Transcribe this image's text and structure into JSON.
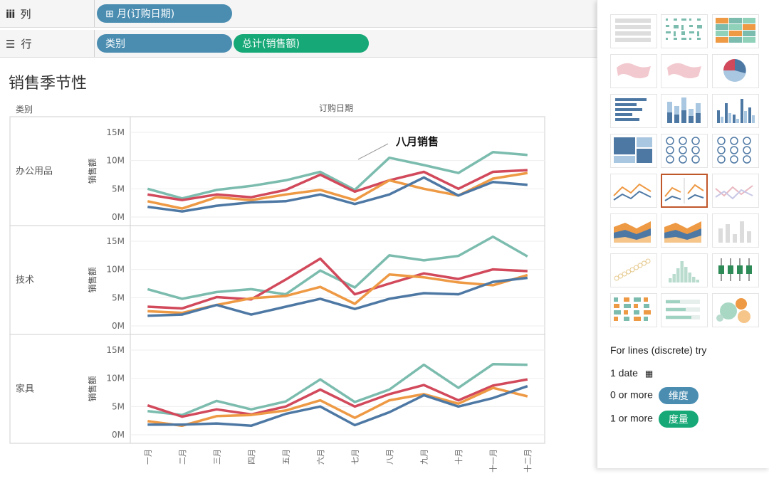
{
  "shelves": {
    "columns": {
      "label": "列",
      "pills": [
        "⊞ 月(订购日期)"
      ]
    },
    "rows": {
      "label": "行",
      "pills": [
        "类别",
        "总计(销售额)"
      ]
    }
  },
  "viz": {
    "title": "销售季节性",
    "col_header": "订购日期",
    "row_header": "类别",
    "annotation": "八月销售"
  },
  "chart_data": {
    "type": "line",
    "x": [
      "一月",
      "二月",
      "三月",
      "四月",
      "五月",
      "六月",
      "七月",
      "八月",
      "九月",
      "十月",
      "十一月",
      "十二月"
    ],
    "ylabel": "销售额",
    "ylim": [
      0,
      16
    ],
    "yticks": [
      "0M",
      "5M",
      "10M",
      "15M"
    ],
    "series_colors": [
      "#7bbcae",
      "#d1495b",
      "#ee9944",
      "#4e78a4"
    ],
    "panels": [
      {
        "category": "办公用品",
        "series": [
          {
            "values": [
              5.0,
              3.3,
              4.8,
              5.5,
              6.5,
              8.0,
              4.8,
              10.5,
              9.2,
              7.8,
              11.5,
              11.0
            ]
          },
          {
            "values": [
              4.0,
              3.0,
              4.0,
              3.5,
              4.8,
              7.5,
              4.5,
              6.5,
              8.0,
              5.0,
              8.0,
              8.3
            ]
          },
          {
            "values": [
              2.8,
              1.5,
              3.5,
              3.0,
              4.0,
              4.8,
              3.0,
              6.5,
              5.0,
              3.8,
              6.8,
              7.8
            ]
          },
          {
            "values": [
              1.8,
              1.0,
              2.0,
              2.6,
              2.8,
              4.0,
              2.3,
              4.0,
              7.0,
              3.8,
              6.2,
              5.7
            ]
          }
        ]
      },
      {
        "category": "技术",
        "series": [
          {
            "values": [
              6.5,
              4.8,
              6.0,
              6.5,
              5.6,
              9.8,
              6.8,
              12.5,
              11.6,
              12.4,
              15.8,
              12.3
            ]
          },
          {
            "values": [
              3.4,
              3.1,
              5.1,
              4.7,
              8.2,
              11.9,
              5.6,
              7.5,
              9.3,
              8.3,
              10.0,
              9.7
            ]
          },
          {
            "values": [
              2.6,
              2.3,
              3.7,
              4.9,
              5.3,
              6.9,
              3.9,
              9.1,
              8.6,
              7.7,
              7.2,
              9.0
            ]
          },
          {
            "values": [
              1.8,
              2.0,
              3.7,
              2.0,
              3.4,
              4.8,
              3.0,
              4.8,
              5.8,
              5.6,
              7.8,
              8.5
            ]
          }
        ]
      },
      {
        "category": "家具",
        "series": [
          {
            "values": [
              4.2,
              3.5,
              6.0,
              4.5,
              5.9,
              9.8,
              5.8,
              8.0,
              12.4,
              8.3,
              12.5,
              12.4
            ]
          },
          {
            "values": [
              5.2,
              3.2,
              4.5,
              3.6,
              5.0,
              8.0,
              5.0,
              7.2,
              8.8,
              6.1,
              8.7,
              9.8
            ]
          },
          {
            "values": [
              2.4,
              1.6,
              3.3,
              3.5,
              4.3,
              6.1,
              3.0,
              6.1,
              7.2,
              5.5,
              8.3,
              6.8
            ]
          },
          {
            "values": [
              1.8,
              1.8,
              2.0,
              1.6,
              3.7,
              5.0,
              1.7,
              4.0,
              7.0,
              5.0,
              6.5,
              8.6
            ]
          }
        ]
      }
    ]
  },
  "show_me": {
    "hint_title": "For lines (discrete) try",
    "req_date": "1 date",
    "req_dim_prefix": "0 or more",
    "req_dim_pill": "维度",
    "req_meas_prefix": "1 or more",
    "req_meas_pill": "度量",
    "colors": {
      "dimension": "#4a8db1",
      "measure": "#17a878",
      "selected": "#c0572b"
    },
    "thumbnails": [
      "text-table",
      "heat-map",
      "highlight-table",
      "symbol-map",
      "filled-map",
      "pie-chart",
      "horizontal-bars",
      "stacked-bars",
      "side-by-side-bars",
      "treemap",
      "circle-views",
      "side-by-side-circles",
      "lines-continuous",
      "lines-discrete",
      "dual-lines",
      "area-continuous",
      "area-discrete",
      "dual-combination",
      "scatter-plot",
      "histogram",
      "box-whisker",
      "gantt-chart",
      "bullet-graph",
      "packed-bubbles"
    ]
  }
}
